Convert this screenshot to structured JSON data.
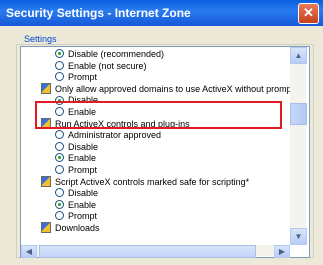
{
  "window": {
    "title": "Security Settings - Internet Zone",
    "close_glyph": "✕"
  },
  "settings": {
    "label": "Settings",
    "items": [
      {
        "kind": "option",
        "label": "Disable (recommended)",
        "checked": true
      },
      {
        "kind": "option",
        "label": "Enable (not secure)",
        "checked": false
      },
      {
        "kind": "option",
        "label": "Prompt",
        "checked": false
      },
      {
        "kind": "category",
        "label": "Only allow approved domains to use ActiveX without prompt",
        "icon": "security-setting-icon"
      },
      {
        "kind": "option",
        "label": "Disable",
        "checked": true
      },
      {
        "kind": "option",
        "label": "Enable",
        "checked": false
      },
      {
        "kind": "category",
        "label": "Run ActiveX controls and plug-ins",
        "icon": "security-setting-icon"
      },
      {
        "kind": "option",
        "label": "Administrator approved",
        "checked": false
      },
      {
        "kind": "option",
        "label": "Disable",
        "checked": false
      },
      {
        "kind": "option",
        "label": "Enable",
        "checked": true
      },
      {
        "kind": "option",
        "label": "Prompt",
        "checked": false
      },
      {
        "kind": "category",
        "label": "Script ActiveX controls marked safe for scripting*",
        "icon": "security-setting-icon"
      },
      {
        "kind": "option",
        "label": "Disable",
        "checked": false
      },
      {
        "kind": "option",
        "label": "Enable",
        "checked": true
      },
      {
        "kind": "option",
        "label": "Prompt",
        "checked": false
      },
      {
        "kind": "category",
        "label": "Downloads",
        "icon": "security-setting-icon"
      }
    ]
  },
  "scrollbars": {
    "up_arrow": "▲",
    "down_arrow": "▼",
    "left_arrow": "◀",
    "right_arrow": "▶"
  },
  "colors": {
    "highlight_box": "#e21b22",
    "title_bar": "#1559d6",
    "radio_checked": "#21a121"
  }
}
